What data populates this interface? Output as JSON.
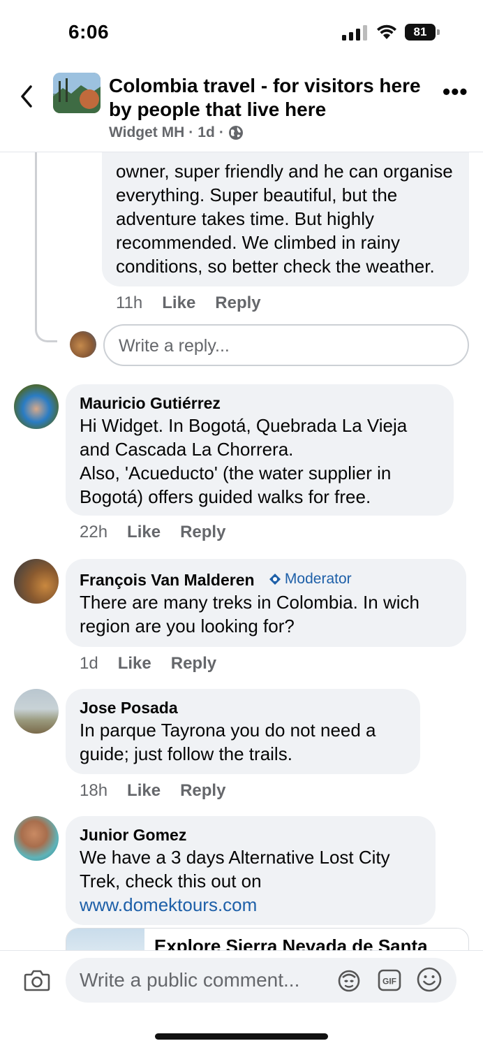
{
  "status_bar": {
    "time": "6:06",
    "battery": "81"
  },
  "header": {
    "group_title": "Colombia travel - for visitors here by people that live here",
    "author": "Widget MH",
    "separator": "·",
    "age": "1d",
    "separator2": "·"
  },
  "reply_thread": {
    "partial_text": "owner, super friendly and he can organise everything. Super beautiful, but the adventure takes time. But highly recommended. We climbed in rainy conditions, so better check the weather.",
    "time": "11h",
    "like": "Like",
    "reply": "Reply",
    "reply_placeholder": "Write a reply..."
  },
  "comments": [
    {
      "author": "Mauricio Gutiérrez",
      "text": "Hi Widget. In Bogotá, Quebrada La Vieja and Cascada La Chorrera.\n Also, 'Acueducto' (the water supplier in Bogotá) offers guided walks for free.",
      "time": "22h",
      "like": "Like",
      "reply": "Reply"
    },
    {
      "author": "François Van Malderen",
      "badge": "Moderator",
      "text": "There are many treks in Colombia. In wich region are you looking for?",
      "time": "1d",
      "like": "Like",
      "reply": "Reply"
    },
    {
      "author": "Jose Posada",
      "text": "In parque Tayrona you do not need a guide; just follow the trails.",
      "time": "18h",
      "like": "Like",
      "reply": "Reply"
    },
    {
      "author": "Junior Gomez",
      "text": "We have a 3 days Alternative Lost City Trek,  check this out on",
      "link": "www.domektours.com",
      "preview_title": "Explore Sierra Nevada de Santa"
    }
  ],
  "composer": {
    "placeholder": "Write a public comment..."
  },
  "colors": {
    "link": "#1d5fa8",
    "bubble": "#f0f2f5",
    "muted": "#65676b"
  }
}
